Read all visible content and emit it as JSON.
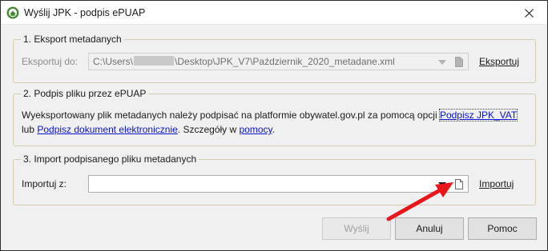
{
  "window": {
    "title": "Wyślij JPK - podpis ePUAP"
  },
  "group1": {
    "title": "1. Eksport metadanych",
    "label": "Eksportuj do:",
    "path_prefix": "C:\\Users\\",
    "path_suffix": "\\Desktop\\JPK_V7\\Październik_2020_metadane.xml",
    "action": "Eksportuj"
  },
  "group2": {
    "title": "2. Podpis pliku przez ePUAP",
    "text_part1": "Wyeksportowany plik metadanych należy podpisać na platformie obywatel.gov.pl za pomocą opcji ",
    "link1": "Podpisz JPK_VAT",
    "text_part2": "lub ",
    "link2": "Podpisz dokument elektronicznie",
    "text_part3": ". Szczegóły w ",
    "link3": "pomocy",
    "text_part4": "."
  },
  "group3": {
    "title": "3. Import podpisanego pliku metadanych",
    "label": "Importuj z:",
    "value": "",
    "action": "Importuj"
  },
  "buttons": {
    "send": "Wyślij",
    "cancel": "Anuluj",
    "help": "Pomoc"
  },
  "colors": {
    "link": "#0a14d0",
    "annotation_arrow": "#e8151b",
    "group_border": "#d4cdb2"
  },
  "icons": {
    "app": "app-logo-icon",
    "close": "close-icon",
    "dropdown": "chevron-down-icon",
    "browse": "document-icon"
  }
}
